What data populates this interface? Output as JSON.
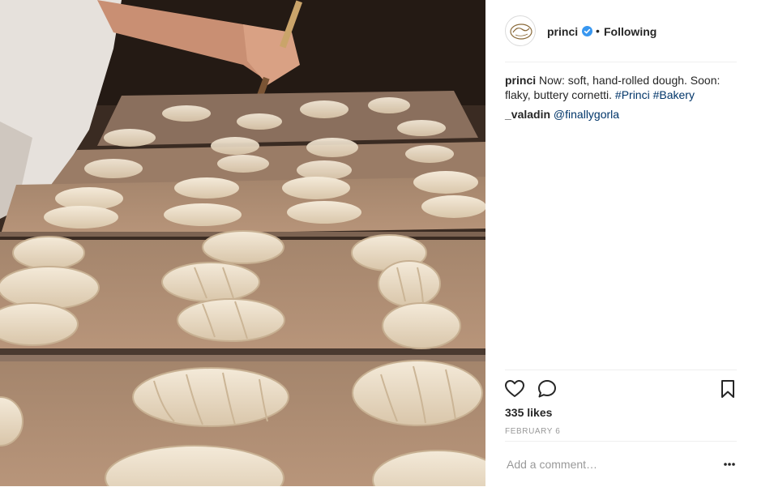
{
  "post": {
    "username": "princi",
    "separator": "•",
    "follow_status": "Following",
    "caption": {
      "user": "princi",
      "text": "Now: soft, hand-rolled dough. Soon: flaky, buttery cornetti.",
      "hashtags": [
        "#Princi",
        "#Bakery"
      ]
    },
    "comments": [
      {
        "user": "_valadin",
        "text": "@finallygorla"
      }
    ],
    "likes": "335 likes",
    "date": "FEBRUARY 6",
    "comment_placeholder": "Add a comment…"
  },
  "photo": {
    "subject": "rows of hand-rolled croissant dough on baking trays"
  },
  "icons": {
    "verified": "verified-badge-icon",
    "like": "heart-icon",
    "comment": "speech-bubble-icon",
    "save": "bookmark-icon",
    "more": "more-options-icon"
  },
  "colors": {
    "accent": "#3897f0",
    "link": "#003569",
    "muted": "#999999",
    "border": "#efefef"
  }
}
